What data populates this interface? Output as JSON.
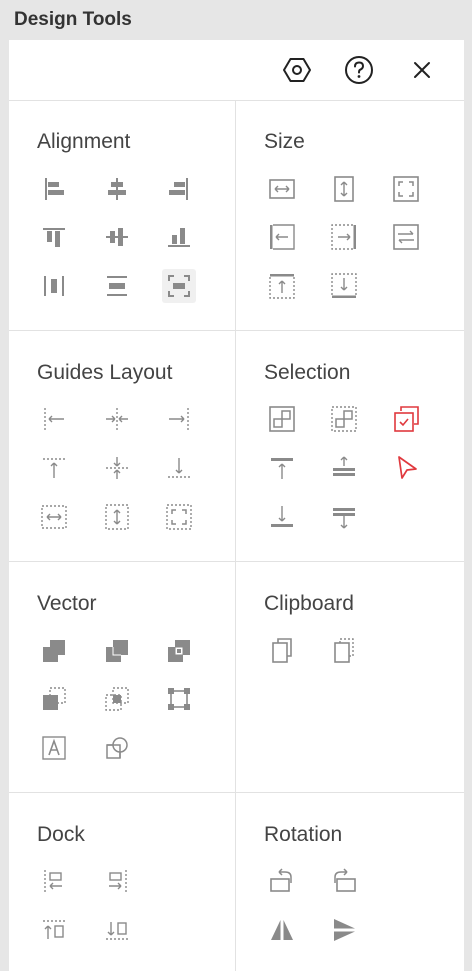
{
  "window": {
    "title": "Design Tools"
  },
  "toolbar": {
    "settings_icon": "hexagon-gear-icon",
    "help_icon": "question-circle-icon",
    "close_icon": "close-icon"
  },
  "sections": {
    "alignment": {
      "title": "Alignment",
      "items": [
        "align-left-icon",
        "align-center-horizontal-icon",
        "align-right-icon",
        "align-top-icon",
        "align-middle-vertical-icon",
        "align-bottom-icon",
        "distribute-horizontal-icon",
        "distribute-vertical-icon",
        "center-on-canvas-icon"
      ]
    },
    "size": {
      "title": "Size",
      "items": [
        "same-width-icon",
        "same-height-icon",
        "same-size-icon",
        "stretch-left-icon",
        "stretch-right-icon",
        "swap-width-height-icon",
        "stretch-top-icon",
        "stretch-bottom-icon"
      ]
    },
    "guides_layout": {
      "title": "Guides Layout",
      "items": [
        "snap-left-guide-icon",
        "snap-center-vertical-guide-icon",
        "snap-right-guide-icon",
        "snap-top-guide-icon",
        "snap-center-horizontal-guide-icon",
        "snap-bottom-guide-icon",
        "fit-width-guides-icon",
        "fit-height-guides-icon",
        "fit-all-guides-icon"
      ]
    },
    "selection": {
      "title": "Selection",
      "items": [
        "select-all-icon",
        "select-similar-icon",
        "select-checked-icon",
        "select-above-icon",
        "select-middle-icon",
        "pointer-select-icon",
        "select-below-icon",
        "select-group-icon"
      ]
    },
    "vector": {
      "title": "Vector",
      "items": [
        "union-icon",
        "subtract-icon",
        "intersect-icon",
        "exclude-icon",
        "divide-icon",
        "path-bounds-icon",
        "text-to-path-icon",
        "outline-shape-icon"
      ]
    },
    "clipboard": {
      "title": "Clipboard",
      "items": [
        "copy-icon",
        "paste-in-place-icon"
      ]
    },
    "dock": {
      "title": "Dock",
      "items": [
        "dock-left-icon",
        "dock-right-icon",
        "dock-top-icon",
        "dock-bottom-icon"
      ]
    },
    "rotation": {
      "title": "Rotation",
      "items": [
        "rotate-left-icon",
        "rotate-right-icon",
        "flip-horizontal-icon",
        "flip-vertical-icon"
      ]
    }
  },
  "colors": {
    "icon": "#8a8a8a",
    "accent_red": "#e0393e",
    "divider": "#e2e2e2",
    "background": "#e6e6e6"
  }
}
